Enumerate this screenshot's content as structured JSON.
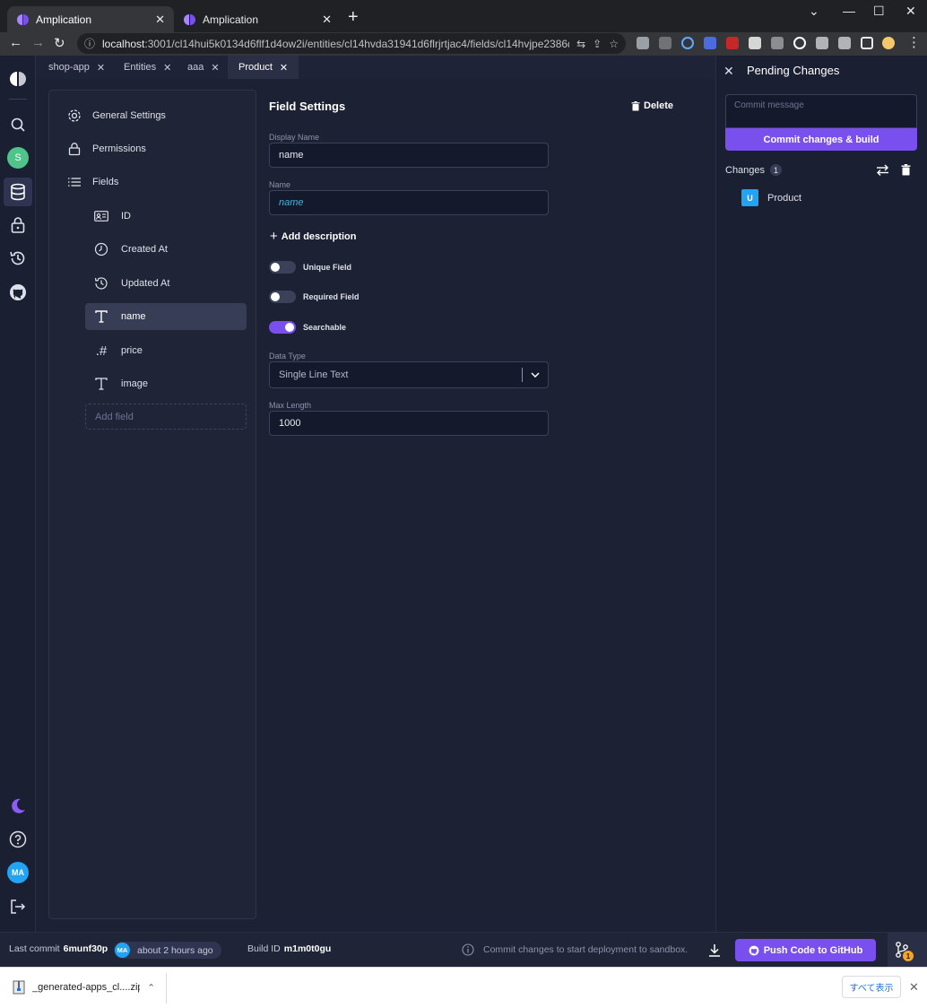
{
  "browser": {
    "tabs": [
      {
        "title": "Amplication"
      },
      {
        "title": "Amplication"
      }
    ],
    "url_host": "localhost",
    "url_rest": ":3001/cl14hui5k0134d6flf1d4ow2i/entities/cl14hvda31941d6flrjrtjac4/fields/cl14hvjpe2386d6fl..."
  },
  "app_tabs": [
    {
      "label": "shop-app"
    },
    {
      "label": "Entities"
    },
    {
      "label": "aaa"
    },
    {
      "label": "Product"
    }
  ],
  "rail": {
    "user_initial": "S",
    "avatar": "MA"
  },
  "sidebar": {
    "general_settings": "General Settings",
    "permissions": "Permissions",
    "fields": "Fields",
    "field_items": [
      {
        "label": "ID",
        "icon": "id-card-icon"
      },
      {
        "label": "Created At",
        "icon": "clock-icon"
      },
      {
        "label": "Updated At",
        "icon": "clock-refresh-icon"
      },
      {
        "label": "name",
        "icon": "text-icon"
      },
      {
        "label": "price",
        "icon": "decimal-number-icon"
      },
      {
        "label": "image",
        "icon": "text-icon"
      }
    ],
    "add_field_placeholder": "Add field"
  },
  "field_settings": {
    "title": "Field Settings",
    "delete_label": "Delete",
    "display_name_label": "Display Name",
    "display_name_value": "name",
    "name_label": "Name",
    "name_value": "name",
    "add_description": "Add description",
    "unique_field": "Unique Field",
    "unique_field_on": false,
    "required_field": "Required Field",
    "required_field_on": false,
    "searchable": "Searchable",
    "searchable_on": true,
    "data_type_label": "Data Type",
    "data_type_value": "Single Line Text",
    "max_length_label": "Max Length",
    "max_length_value": "1000"
  },
  "pending": {
    "title": "Pending Changes",
    "commit_placeholder": "Commit message",
    "commit_button": "Commit changes & build",
    "changes_label": "Changes",
    "changes_count": "1",
    "change_items": [
      {
        "badge": "U",
        "name": "Product"
      }
    ]
  },
  "bottom": {
    "last_commit_label": "Last commit",
    "last_commit_id": "6munf30p",
    "avatar": "MA",
    "time": "about 2 hours ago",
    "build_id_label": "Build ID",
    "build_id": "m1m0t0gu",
    "info": "Commit changes to start deployment to sandbox.",
    "push_button": "Push Code to GitHub",
    "pending_badge": "1"
  },
  "downloads": {
    "file": "_generated-apps_cl....zip",
    "show_all": "すべて表示"
  },
  "colors": {
    "accent": "#7950ed",
    "background": "#15192c",
    "panel": "#1f2436",
    "name_text": "#41b1e5"
  }
}
